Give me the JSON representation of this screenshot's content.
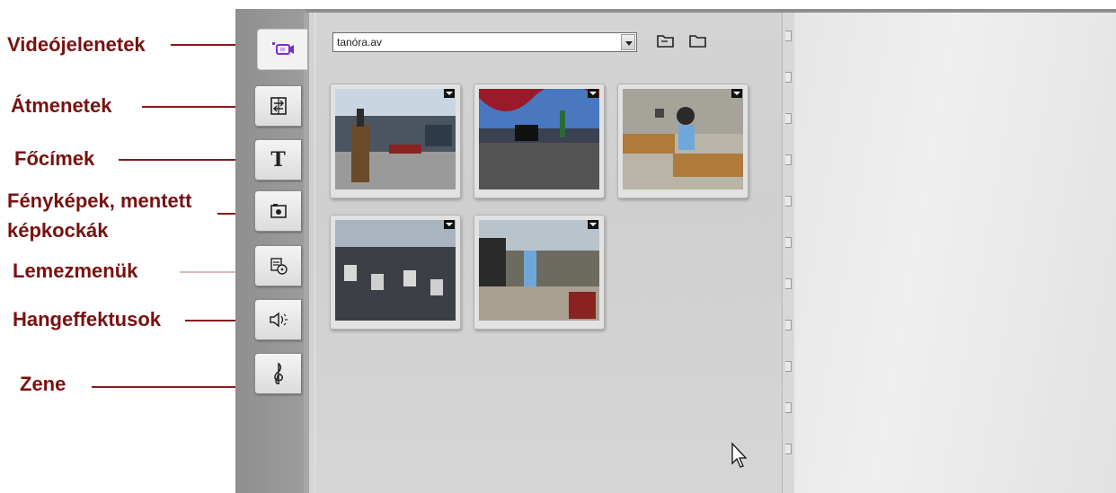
{
  "annotations": [
    {
      "id": "videojelenetek",
      "text": "Videójelenetek"
    },
    {
      "id": "atmenetek",
      "text": "Átmenetek"
    },
    {
      "id": "focimek",
      "text": "Főcímek"
    },
    {
      "id": "fenykepek_1",
      "text": "Fényképek, mentett"
    },
    {
      "id": "fenykepek_2",
      "text": "képkockák"
    },
    {
      "id": "lemezmenuk",
      "text": "Lemezmenük"
    },
    {
      "id": "hangeffektusok",
      "text": "Hangeffektusok"
    },
    {
      "id": "zene",
      "text": "Zene"
    }
  ],
  "tabs": [
    {
      "name": "video-scenes",
      "icon": "video-camera-icon",
      "active": true
    },
    {
      "name": "transitions",
      "icon": "transition-icon"
    },
    {
      "name": "titles",
      "icon": "title-t-icon",
      "letter": "T"
    },
    {
      "name": "photos",
      "icon": "camera-photo-icon"
    },
    {
      "name": "disc-menus",
      "icon": "disc-menu-icon"
    },
    {
      "name": "sound-effects",
      "icon": "speaker-icon"
    },
    {
      "name": "music",
      "icon": "treble-clef-icon"
    }
  ],
  "album": {
    "file_select": "tanóra.av",
    "toolbar_icons": [
      "folder-open-icon",
      "folder-icon"
    ]
  },
  "colors": {
    "annotation": "#7a1010",
    "app_frame": "#8e8e8e",
    "album_page": "#d4d4d4"
  }
}
